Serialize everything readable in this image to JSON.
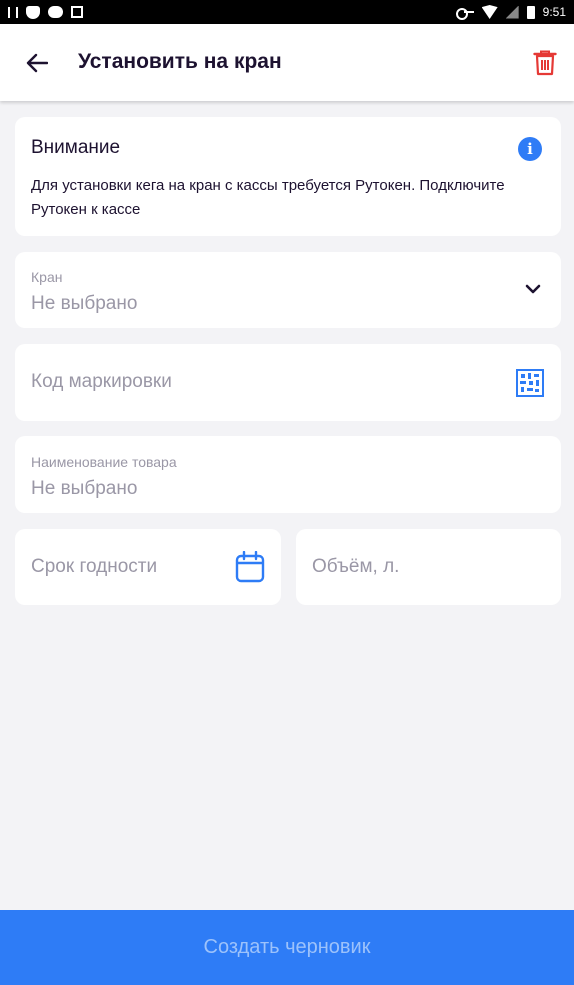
{
  "status_bar": {
    "time": "9:51"
  },
  "header": {
    "title": "Установить на кран"
  },
  "notice": {
    "title": "Внимание",
    "text": "Для установки кега на кран с кассы требуется Рутокен. Подключите Рутокен к кассе"
  },
  "form": {
    "crane": {
      "label": "Кран",
      "value": "Не выбрано"
    },
    "marking": {
      "placeholder": "Код маркировки"
    },
    "product": {
      "label": "Наименование товара",
      "value": "Не выбрано"
    },
    "expiry": {
      "placeholder": "Срок годности"
    },
    "volume": {
      "placeholder": "Объём, л."
    }
  },
  "footer": {
    "create_draft_label": "Создать черновик"
  },
  "colors": {
    "accent": "#2e7cf6",
    "danger": "#e53935",
    "title": "#1d1230",
    "muted": "#9a97a6",
    "background": "#f3f3f6"
  }
}
